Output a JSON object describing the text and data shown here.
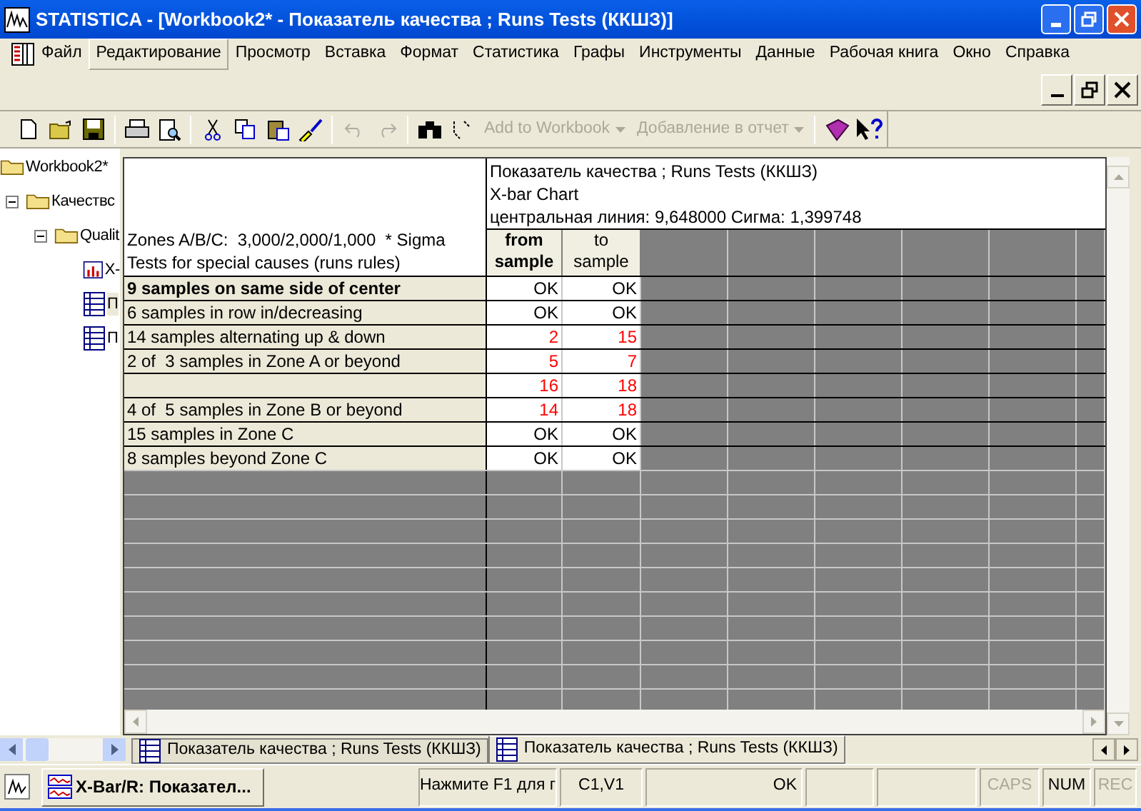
{
  "window": {
    "title": "STATISTICA - [Workbook2* - Показатель качества ; Runs Tests (ККШЗ)]"
  },
  "menu": [
    {
      "label": "Файл",
      "selected": false
    },
    {
      "label": "Редактирование",
      "selected": true
    },
    {
      "label": "Просмотр",
      "selected": false
    },
    {
      "label": "Вставка",
      "selected": false
    },
    {
      "label": "Формат",
      "selected": false
    },
    {
      "label": "Статистика",
      "selected": false
    },
    {
      "label": "Графы",
      "selected": false
    },
    {
      "label": "Инструменты",
      "selected": false
    },
    {
      "label": "Данные",
      "selected": false
    },
    {
      "label": "Рабочая книга",
      "selected": false
    },
    {
      "label": "Окно",
      "selected": false
    },
    {
      "label": "Справка",
      "selected": false
    }
  ],
  "toolbar": {
    "dropdowns": [
      {
        "label": "Add to Workbook",
        "disabled": true
      },
      {
        "label": "Добавление в отчет",
        "disabled": true
      }
    ]
  },
  "tree": [
    {
      "label": "Workbook2*",
      "kind": "folder",
      "children": [
        {
          "label": "Качествс",
          "kind": "folder",
          "expanded": true,
          "children": [
            {
              "label": "Qualit",
              "kind": "folder",
              "expanded": true,
              "children": [
                {
                  "label": "X-",
                  "kind": "graph",
                  "selected": false
                },
                {
                  "label": "П",
                  "kind": "sheet",
                  "selected": true
                },
                {
                  "label": "П",
                  "kind": "sheet",
                  "selected": false
                }
              ]
            }
          ]
        }
      ]
    }
  ],
  "sheet": {
    "title_lines": [
      "Показатель качества ; Runs Tests (ККШЗ)",
      "X-bar Chart",
      "центральная линия: 9,648000 Сигма: 1,399748"
    ],
    "header_lines": [
      "Zones A/B/C:  3,000/2,000/1,000  * Sigma",
      "Tests for special causes (runs rules)"
    ],
    "columns": [
      {
        "lines": [
          "from",
          "sample"
        ],
        "bold": true
      },
      {
        "lines": [
          "to",
          "sample"
        ],
        "bold": false
      }
    ],
    "rows": [
      {
        "label": "9 samples on same side of center",
        "bold": true,
        "values": [
          {
            "text": "OK",
            "flagged": false
          },
          {
            "text": "OK",
            "flagged": false
          }
        ]
      },
      {
        "label": "6 samples in row in/decreasing",
        "bold": false,
        "values": [
          {
            "text": "OK",
            "flagged": false
          },
          {
            "text": "OK",
            "flagged": false
          }
        ]
      },
      {
        "label": "14 samples alternating up & down",
        "bold": false,
        "values": [
          {
            "text": "2",
            "flagged": true
          },
          {
            "text": "15",
            "flagged": true
          }
        ]
      },
      {
        "label": "2 of  3 samples in Zone A or beyond",
        "bold": false,
        "values": [
          {
            "text": "5",
            "flagged": true
          },
          {
            "text": "7",
            "flagged": true
          }
        ]
      },
      {
        "bold": false,
        "values": [
          {
            "text": "16",
            "flagged": true
          },
          {
            "text": "18",
            "flagged": true
          }
        ]
      },
      {
        "label": "4 of  5 samples in Zone B or beyond",
        "bold": false,
        "values": [
          {
            "text": "14",
            "flagged": true
          },
          {
            "text": "18",
            "flagged": true
          }
        ]
      },
      {
        "label": "15 samples in Zone C",
        "bold": false,
        "values": [
          {
            "text": "OK",
            "flagged": false
          },
          {
            "text": "OK",
            "flagged": false
          }
        ]
      },
      {
        "label": "8 samples beyond Zone C",
        "bold": false,
        "values": [
          {
            "text": "OK",
            "flagged": false
          },
          {
            "text": "OK",
            "flagged": false
          }
        ]
      }
    ]
  },
  "tabs": [
    {
      "label": "Показатель качества ; Runs Tests (ККШЗ)",
      "selected": false
    },
    {
      "label": "Показатель качества ; Runs Tests (ККШЗ)",
      "selected": true
    }
  ],
  "taskbar_button": {
    "label": "X-Bar/R: Показател..."
  },
  "status_bar": [
    {
      "kind": "text",
      "text": "Нажмите F1 для г",
      "disabled": false
    },
    {
      "kind": "text",
      "text": "C1,V1",
      "disabled": false
    },
    {
      "kind": "text",
      "text": "OK",
      "disabled": false
    },
    {
      "kind": "blank"
    },
    {
      "kind": "blank"
    },
    {
      "kind": "text",
      "text": "CAPS",
      "disabled": true
    },
    {
      "kind": "text",
      "text": "NUM",
      "disabled": false
    },
    {
      "kind": "text",
      "text": "REC",
      "disabled": true
    }
  ]
}
